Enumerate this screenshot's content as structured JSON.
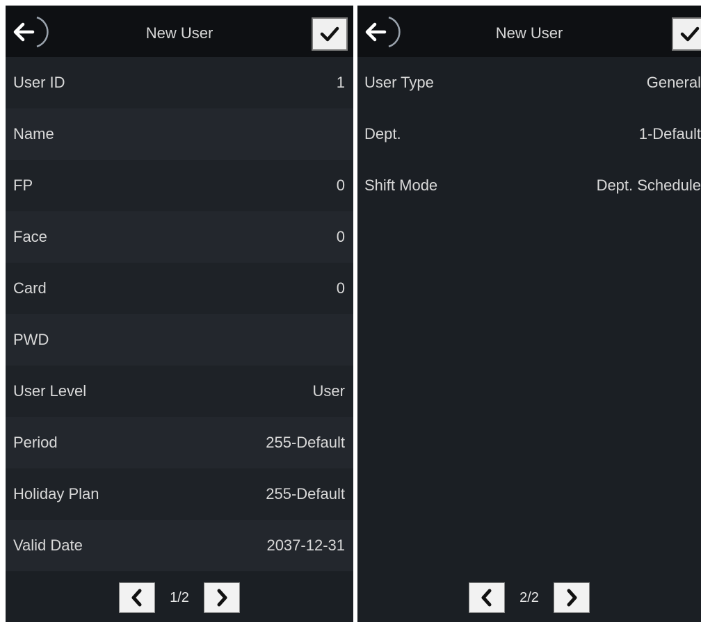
{
  "colors": {
    "panel_bg": "#1b1f24",
    "header_bg": "#0e1013",
    "row_bg_a": "#1e2227",
    "row_bg_b": "#23272d",
    "button_bg": "#f0f0f0",
    "text": "#d9d9d9"
  },
  "icons": {
    "back": "arrow-left-icon",
    "confirm": "checkmark-icon",
    "prev": "chevron-left-icon",
    "next": "chevron-right-icon"
  },
  "page1": {
    "title": "New User",
    "rows": [
      {
        "label": "User ID",
        "value": "1"
      },
      {
        "label": "Name",
        "value": ""
      },
      {
        "label": "FP",
        "value": "0"
      },
      {
        "label": "Face",
        "value": "0"
      },
      {
        "label": "Card",
        "value": "0"
      },
      {
        "label": "PWD",
        "value": ""
      },
      {
        "label": "User Level",
        "value": "User"
      },
      {
        "label": "Period",
        "value": "255-Default"
      },
      {
        "label": "Holiday Plan",
        "value": "255-Default"
      },
      {
        "label": "Valid Date",
        "value": "2037-12-31"
      }
    ],
    "pager": "1/2"
  },
  "page2": {
    "title": "New User",
    "rows": [
      {
        "label": "User Type",
        "value": "General"
      },
      {
        "label": "Dept.",
        "value": "1-Default"
      },
      {
        "label": "Shift Mode",
        "value": "Dept. Schedule"
      }
    ],
    "pager": "2/2"
  }
}
